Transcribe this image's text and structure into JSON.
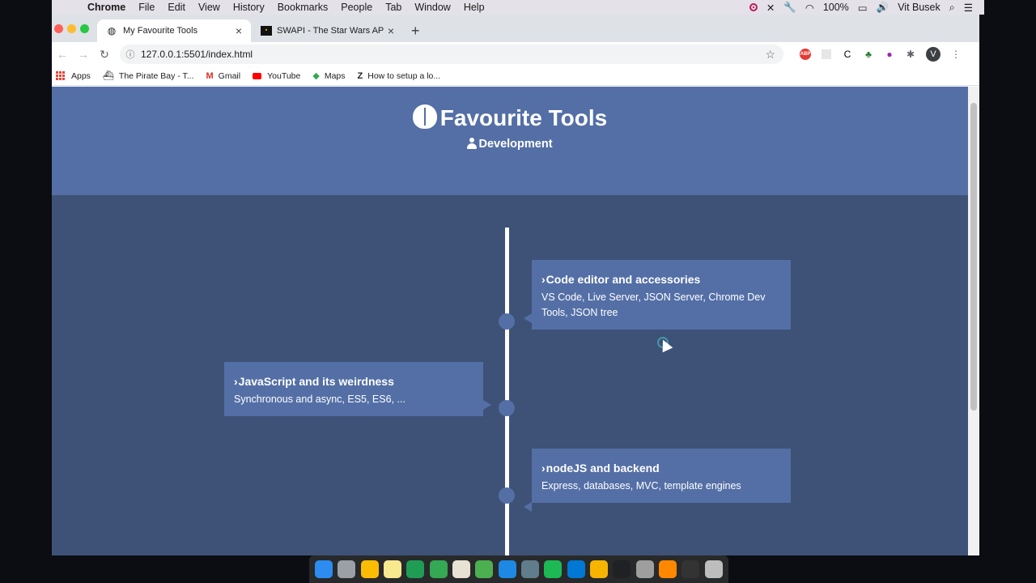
{
  "menubar": {
    "app": "Chrome",
    "menus": [
      "File",
      "Edit",
      "View",
      "History",
      "Bookmarks",
      "People",
      "Tab",
      "Window",
      "Help"
    ],
    "battery": "100%",
    "user": "Vit Busek"
  },
  "tabs": [
    {
      "title": "My Favourite Tools",
      "active": true
    },
    {
      "title": "SWAPI - The Star Wars API",
      "active": false
    }
  ],
  "toolbar": {
    "url": "127.0.0.1:5501/index.html",
    "avatar_letter": "V"
  },
  "bookmarks": [
    "Apps",
    "The Pirate Bay - T...",
    "Gmail",
    "YouTube",
    "Maps",
    "How to setup a lo..."
  ],
  "page": {
    "title": "Favourite Tools",
    "subtitle": "Development",
    "timeline": [
      {
        "title": "Code editor and accessories",
        "desc": "VS Code, Live Server, JSON Server, Chrome Dev Tools, JSON tree"
      },
      {
        "title": "JavaScript and its weirdness",
        "desc": "Synchronous and async, ES5, ES6, ..."
      },
      {
        "title": "nodeJS and backend",
        "desc": "Express, databases, MVC, template engines"
      }
    ]
  },
  "dock": {
    "colors": [
      "#2d8cf0",
      "#9aa0a6",
      "#fbbc04",
      "#f7e98e",
      "#1f9d55",
      "#34a853",
      "#e8e2d4",
      "#4caf50",
      "#1e88e5",
      "#607d8b",
      "#1db954",
      "#0078d4",
      "#f7b500",
      "#202124",
      "#9e9e9e",
      "#ff8800",
      "#333333",
      "#bdbdbd"
    ]
  }
}
